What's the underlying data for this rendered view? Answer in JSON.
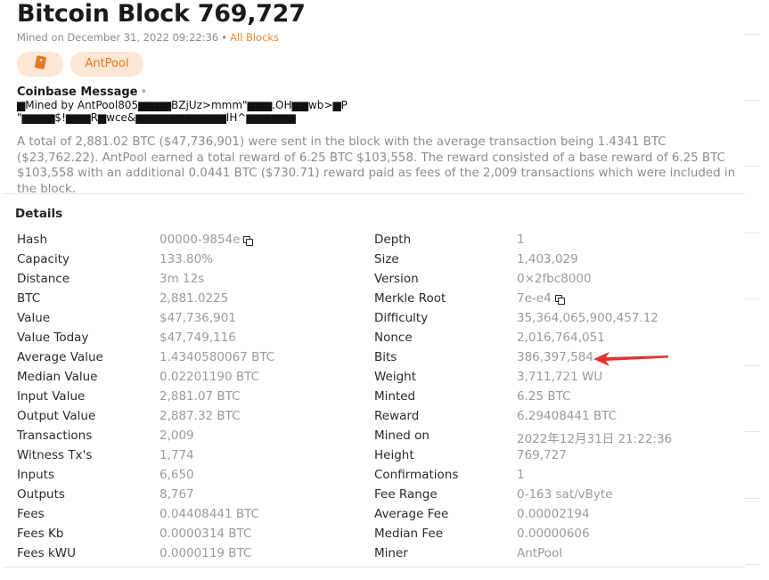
{
  "header": {
    "title_prefix": "Bitcoin Block",
    "block_number": "769,727",
    "mined_on": "Mined on December 31, 2022 09:22:36",
    "separator": "•",
    "all_blocks_link": "All Blocks"
  },
  "badges": {
    "miner_label": "AntPool"
  },
  "coinbase": {
    "label": "Coinbase Message",
    "dot": "•",
    "line1": "▆Mined by AntPool805▆▆▆▆BZjUz>mmm\"▆▆▆.OH▆▆wb>▆P",
    "line2": "\"▆▆▆▆$!▆▆▆R▆wce&▆▆▆▆▆▆▆▆▆▆▆IH^▆▆▆▆▆▆"
  },
  "summary": "A total of 2,881.02 BTC ($47,736,901) were sent in the block with the average transaction being 1.4341 BTC ($23,762.22). AntPool earned a total reward of 6.25 BTC $103,558. The reward consisted of a base reward of 6.25 BTC $103,558 with an additional 0.0441 BTC ($730.71) reward paid as fees of the 2,009 transactions which were included in the block.",
  "details": {
    "title": "Details",
    "left": [
      {
        "key": "Hash",
        "value": "00000-9854e",
        "copy": true
      },
      {
        "key": "Capacity",
        "value": "133.80%"
      },
      {
        "key": "Distance",
        "value": "3m 12s"
      },
      {
        "key": "BTC",
        "value": "2,881.0225"
      },
      {
        "key": "Value",
        "value": "$47,736,901"
      },
      {
        "key": "Value Today",
        "value": "$47,749,116"
      },
      {
        "key": "Average Value",
        "value": "1.4340580067 BTC"
      },
      {
        "key": "Median Value",
        "value": "0.02201190 BTC"
      },
      {
        "key": "Input Value",
        "value": "2,881.07 BTC"
      },
      {
        "key": "Output Value",
        "value": "2,887.32 BTC"
      },
      {
        "key": "Transactions",
        "value": "2,009"
      },
      {
        "key": "Witness Tx's",
        "value": "1,774"
      },
      {
        "key": "Inputs",
        "value": "6,650"
      },
      {
        "key": "Outputs",
        "value": "8,767"
      },
      {
        "key": "Fees",
        "value": "0.04408441 BTC"
      },
      {
        "key": "Fees Kb",
        "value": "0.0000314 BTC"
      },
      {
        "key": "Fees kWU",
        "value": "0.0000119 BTC"
      }
    ],
    "right": [
      {
        "key": "Depth",
        "value": "1"
      },
      {
        "key": "Size",
        "value": "1,403,029"
      },
      {
        "key": "Version",
        "value": "0×2fbc8000"
      },
      {
        "key": "Merkle Root",
        "value": "7e-e4",
        "copy": true
      },
      {
        "key": "Difficulty",
        "value": "35,364,065,900,457.12"
      },
      {
        "key": "Nonce",
        "value": "2,016,764,051"
      },
      {
        "key": "Bits",
        "value": "386,397,584"
      },
      {
        "key": "Weight",
        "value": "3,711,721 WU"
      },
      {
        "key": "Minted",
        "value": "6.25 BTC"
      },
      {
        "key": "Reward",
        "value": "6.29408441 BTC"
      },
      {
        "key": "Mined on",
        "value": "2022年12月31日 21:22:36"
      },
      {
        "key": "Height",
        "value": "769,727"
      },
      {
        "key": "Confirmations",
        "value": "1"
      },
      {
        "key": "Fee Range",
        "value": "0-163 sat/vByte"
      },
      {
        "key": "Average Fee",
        "value": "0.00002194"
      },
      {
        "key": "Median Fee",
        "value": "0.00000606"
      },
      {
        "key": "Miner",
        "value": "AntPool"
      }
    ]
  },
  "colors": {
    "accent": "#e4781f",
    "badge_bg": "#fbe7d4",
    "link": "#e88a3a",
    "annotation_arrow": "#e5322d"
  },
  "icons": {
    "badge_tag": "tag-icon",
    "copy": "copy-icon",
    "annotation": "red-arrow-icon"
  }
}
